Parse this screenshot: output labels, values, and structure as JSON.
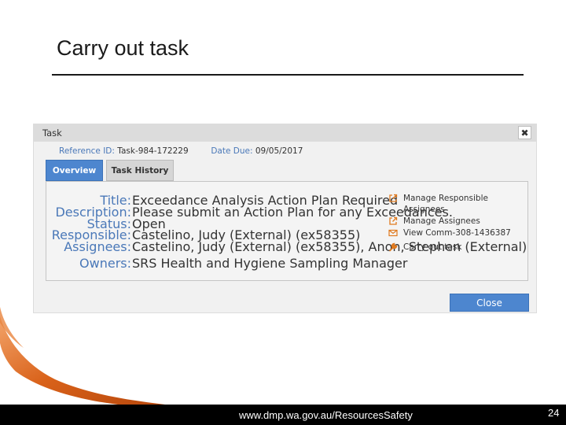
{
  "slide": {
    "title": "Carry out task",
    "footer_url": "www.dmp.wa.gov.au/ResourcesSafety",
    "page_number": "24"
  },
  "dialog": {
    "title": "Task",
    "close_icon_glyph": "✖",
    "reference_label": "Reference ID:",
    "reference_value": "Task-984-172229",
    "date_due_label": "Date Due:",
    "date_due_value": "09/05/2017",
    "tabs": [
      {
        "label": "Overview",
        "active": true
      },
      {
        "label": "Task History",
        "active": false
      }
    ],
    "fields": [
      {
        "label": "Title:",
        "value": "Exceedance Analysis Action Plan Required"
      },
      {
        "label": "Description:",
        "value": "Please submit an Action Plan for any Exceedances."
      },
      {
        "label": "Status:",
        "value": "Open"
      },
      {
        "label": "Responsible:",
        "value": "Castelino, Judy (External) (ex58355)"
      },
      {
        "label": "Assignees:",
        "value": "Castelino, Judy (External) (ex58355), Anon, Stephen (External)"
      },
      {
        "label": "Owners:",
        "value": "SRS Health and Hygiene Sampling Manager"
      }
    ],
    "actions": [
      {
        "label": "Manage Responsible Assignees",
        "icon": "external-link-icon"
      },
      {
        "label": "Manage Assignees",
        "icon": "external-link-icon"
      },
      {
        "label": "View Comm-308-1436387",
        "icon": "envelope-icon"
      },
      {
        "label": "Carry out task",
        "icon": "wrench-icon"
      }
    ],
    "close_button_label": "Close"
  },
  "colors": {
    "accent_blue": "#4d86cf",
    "label_blue": "#4a78b8",
    "icon_orange": "#e07a1f",
    "swoosh_orange": "#d9621a"
  }
}
